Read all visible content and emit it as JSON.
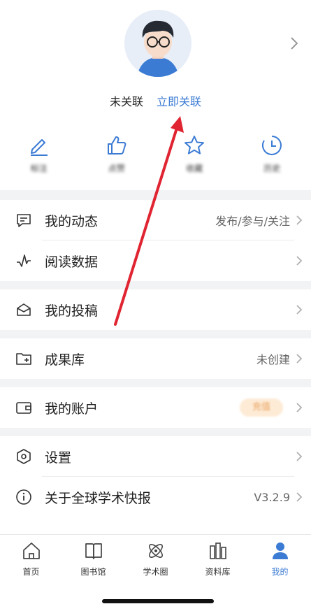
{
  "header": {
    "status": "未关联",
    "link_label": "立即关联"
  },
  "quick_actions": [
    {
      "icon": "edit-icon",
      "label": "标注"
    },
    {
      "icon": "thumbs-up-icon",
      "label": "点赞"
    },
    {
      "icon": "star-icon",
      "label": "收藏"
    },
    {
      "icon": "history-icon",
      "label": "历史"
    }
  ],
  "menu": {
    "my_activity": {
      "label": "我的动态",
      "value": "发布/参与/关注"
    },
    "reading_data": {
      "label": "阅读数据"
    },
    "my_submissions": {
      "label": "我的投稿"
    },
    "achievements": {
      "label": "成果库",
      "value": "未创建"
    },
    "my_account": {
      "label": "我的账户",
      "badge": "充值"
    },
    "settings": {
      "label": "设置"
    },
    "about": {
      "label": "关于全球学术快报",
      "value": "V3.2.9"
    }
  },
  "tabbar": [
    {
      "label": "首页",
      "icon": "home-icon"
    },
    {
      "label": "图书馆",
      "icon": "book-icon"
    },
    {
      "label": "学术圈",
      "icon": "atom-icon"
    },
    {
      "label": "资料库",
      "icon": "library-icon"
    },
    {
      "label": "我的",
      "icon": "user-icon",
      "active": true
    }
  ],
  "colors": {
    "accent": "#3b7bd4",
    "band": "#f2f3f5",
    "annotation_arrow": "#e02431"
  }
}
